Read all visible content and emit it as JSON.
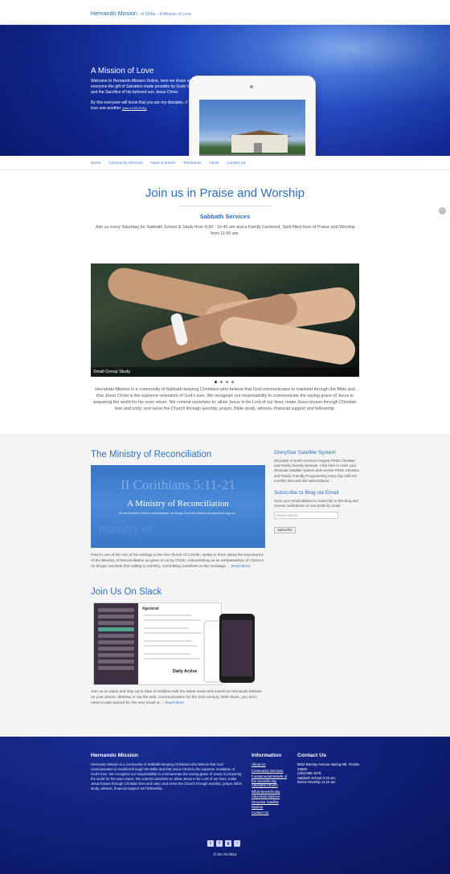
{
  "site": {
    "title": "Hernando Mission",
    "tagline": "of SDAs – A Mission of Love"
  },
  "hero": {
    "title": "A Mission of Love",
    "paragraph1": "Welcome to Hernando Mission Online, here we share with everyone the gift of Salvation made possible by Gods love and the Sacrifice of his beloved son Jesus Christ.",
    "paragraph2": "By this everyone will know that you are my disciples, if you love one another",
    "verse": "(John 13:35 (TLB))."
  },
  "nav": {
    "items": [
      "Home",
      "Community Services",
      "News & Events",
      "Resources",
      "About",
      "Contact Us"
    ]
  },
  "main": {
    "title": "Join us in Praise and Worship",
    "sabbath_heading": "Sabbath Services",
    "sabbath_text": "Join us every Saturday for Sabbath School & Study from 9:30 - 10:45 am and a Family Centered, Sprit filled hour of Praise and Worship from 11:00 am.",
    "slide_caption": "Small Group Study",
    "about_text": "Hernando Mission is a community of Sabbath-keeping Christians who believe that God communicates to mankind through the Bible and that Jesus Christ is the supreme revelation of God's love. We recognize our responsibility to communicate the saving grace of Jesus in preparing the world for his soon return. We commit ourselves to: allow Jesus to be Lord of our lives; make Jesus known through Christian love and unity; and serve the Church through worship, prayer, Bible study, witness, financial support and fellowship."
  },
  "posts": {
    "ministry_title": "The Ministry of Reconciliation",
    "ministry_img_big": "II Corithians 5:11-21",
    "ministry_img_sub": "A Ministry of Reconciliation",
    "ministry_img_small": "We are therefore Christ's ambassadors, as though God were making his appeal through us...",
    "ministry_img_ghost": "ministry of",
    "ministry_text": "Paul in one of his one of his writings to the the church of Corinth, spoke to them about the importance of the Ministry of Reconciliation as given to us by Christ. Admonishing us as ambassadors of Christ to no longer overlook this calling to ministry, committing ourselves to the message ...",
    "read_more": "Read More",
    "slack_title": "Join Us On Slack",
    "slack_channel": "#general",
    "slack_daily": "Daily Active",
    "slack_text": "Join us on slack and stay up to date in realtime with the latest news and events at Hernando Mission on your phone, desktop or via the web. Communication for the 21st century. With Slack, you don't need to wait around for the next email or ...",
    "slack_read_more": "Read More"
  },
  "sidebar": {
    "glory_heading": "GloryStar Satellite System",
    "glory_text": "GloryStar is North America's largest FREE Christian and Family friendly Network. Click here to order your Glorystar Satellite System and receive FREE Christian and Family Friendly Programming every day with NO monthly fees and NO subscriptions.",
    "subscribe_heading": "Subscribe to Blog via Email",
    "subscribe_text": "Enter your email address to subscribe to this blog and receive notifications of new posts by email.",
    "email_placeholder": "Email Address",
    "subscribe_button": "Subscribe"
  },
  "footer": {
    "about_heading": "Hernando Mission",
    "about_text": "Hernando Mission is a community of Sabbath-keeping Christians who believe that God communicates to mankind through the Bible and that Jesus Christ is the supreme revelation of God's love. We recognize our responsibility to communicate the saving grace of Jesus in preparing the world for his soon return. We commit ourselves to: allow Jesus to be Lord of our lives; make Jesus known through Christian love and unity; and serve the Church through worship, prayer, Bible study, witness, financial support and fellowship.",
    "info_heading": "Information",
    "info_links": [
      "About Us",
      "Community Services",
      "Fundamental Beliefs of the Seventh-day Adventist Church",
      "What Seventh-day Adventists Believe",
      "Glorystar Satellite System",
      "Contact Us"
    ],
    "contact_heading": "Contact Us",
    "address": "6832 Barclay Avenue Spring Hill, Florida 34609",
    "phone": "(352) 596-1878",
    "sabbath_school": "Sabbath School 9:15 am",
    "divine_worship": "Divine Worship 11:15 am",
    "social": [
      "twitter-icon",
      "facebook-icon",
      "google-plus-icon",
      "rss-icon"
    ],
    "copyright": "© SG Art 2013"
  }
}
